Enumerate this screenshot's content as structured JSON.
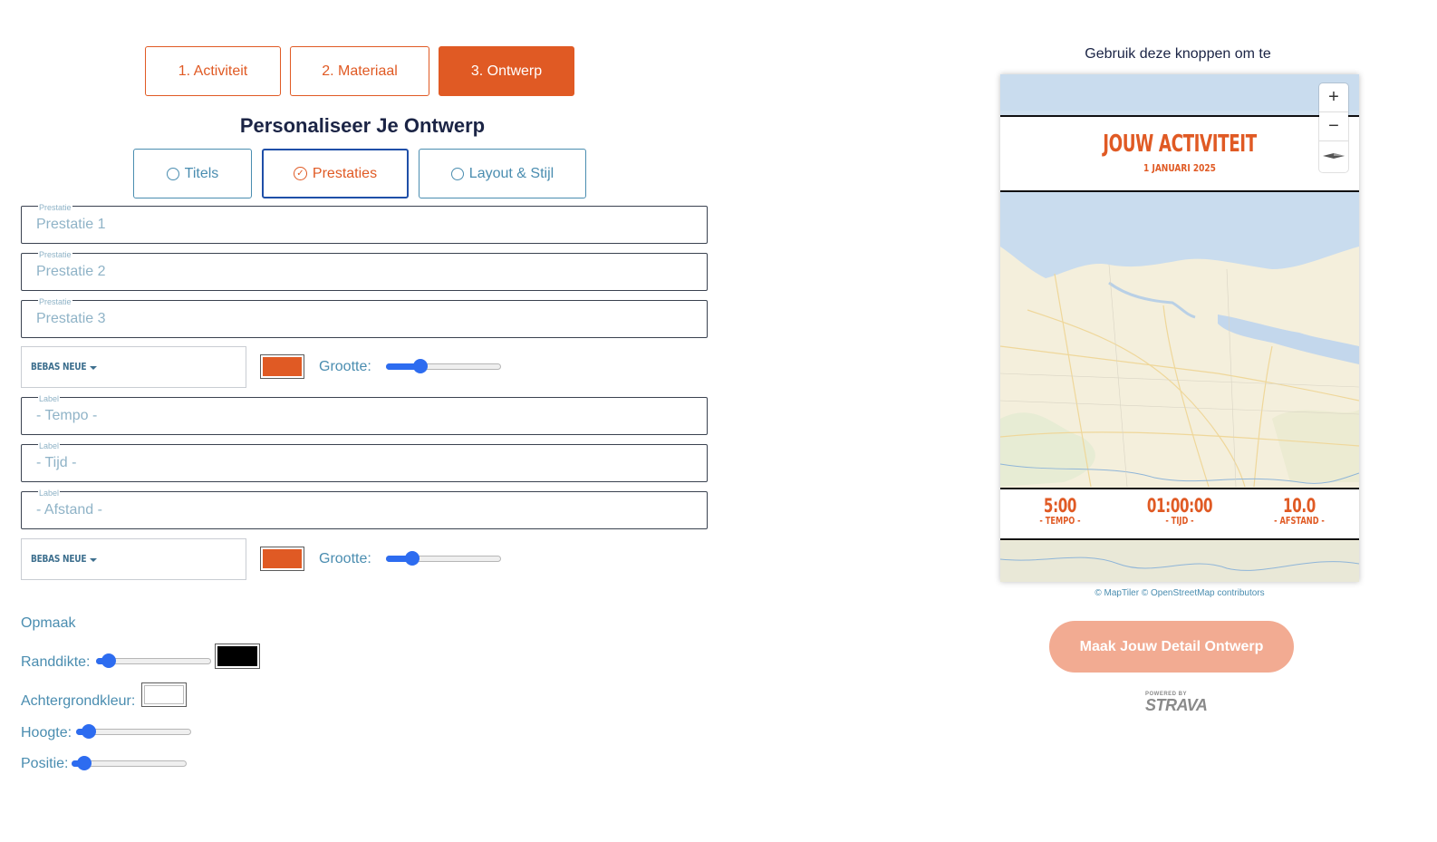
{
  "steps": [
    {
      "label": "1. Activiteit"
    },
    {
      "label": "2. Materiaal"
    },
    {
      "label": "3. Ontwerp"
    }
  ],
  "section_title": "Personaliseer Je Ontwerp",
  "sub_tabs": [
    {
      "label": "Titels"
    },
    {
      "label": "Prestaties"
    },
    {
      "label": "Layout & Stijl"
    }
  ],
  "performance_fields": [
    {
      "label": "Prestatie",
      "placeholder": "Prestatie 1"
    },
    {
      "label": "Prestatie",
      "placeholder": "Prestatie 2"
    },
    {
      "label": "Prestatie",
      "placeholder": "Prestatie 3"
    }
  ],
  "value_style": {
    "font": "BEBAS NEUE",
    "color": "#e05a24",
    "size_label": "Grootte:",
    "size_level": 0.27
  },
  "label_fields": [
    {
      "label": "Label",
      "placeholder": "- Tempo -"
    },
    {
      "label": "Label",
      "placeholder": "- Tijd -"
    },
    {
      "label": "Label",
      "placeholder": "- Afstand -"
    }
  ],
  "label_style": {
    "font": "BEBAS NEUE",
    "color": "#e05a24",
    "size_label": "Grootte:",
    "size_level": 0.19
  },
  "opmaak": {
    "heading": "Opmaak",
    "border_label": "Randdikte:",
    "border_level": 0.05,
    "border_color": "#000000",
    "background_label": "Achtergrondkleur:",
    "background_color": "#ffffff",
    "height_label": "Hoogte:",
    "height_level": 0.05,
    "position_label": "Positie:",
    "position_level": 0.05
  },
  "preview": {
    "hint": "Gebruik deze knoppen om te",
    "title": "JOUW ACTIVITEIT",
    "date": "1 JANUARI 2025",
    "stats": [
      {
        "value": "5:00",
        "label": "- TEMPO -"
      },
      {
        "value": "01:00:00",
        "label": "- TIJD -"
      },
      {
        "value": "10.0",
        "label": "- AFSTAND -"
      }
    ],
    "zoom_in": "+",
    "zoom_out": "−",
    "attribution": "© MapTiler © OpenStreetMap contributors",
    "accent_color": "#e05a24"
  },
  "cta_label": "Maak Jouw Detail Ontwerp",
  "strava": {
    "powered_by": "POWERED BY",
    "brand": "STRAVA"
  }
}
